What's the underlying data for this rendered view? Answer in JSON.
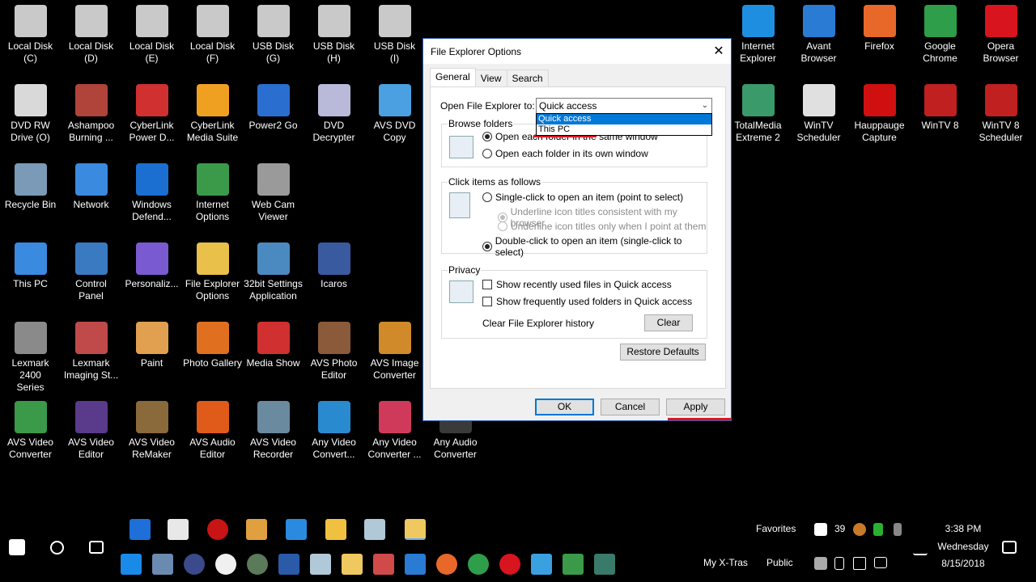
{
  "desktop": {
    "icons": [
      {
        "id": "local-disk-c",
        "label": "Local Disk\n(C)",
        "color": "#c9c9c9"
      },
      {
        "id": "local-disk-d",
        "label": "Local Disk\n(D)",
        "color": "#c9c9c9"
      },
      {
        "id": "local-disk-e",
        "label": "Local Disk\n(E)",
        "color": "#c9c9c9"
      },
      {
        "id": "local-disk-f",
        "label": "Local Disk\n(F)",
        "color": "#c9c9c9"
      },
      {
        "id": "usb-disk-g",
        "label": "USB Disk\n(G)",
        "color": "#c9c9c9"
      },
      {
        "id": "usb-disk-h",
        "label": "USB Disk\n(H)",
        "color": "#c9c9c9"
      },
      {
        "id": "usb-disk-i",
        "label": "USB Disk\n(I)",
        "color": "#c9c9c9"
      },
      {
        "id": "internet-explorer",
        "label": "Internet\nExplorer",
        "color": "#1e8fe0"
      },
      {
        "id": "avant-browser",
        "label": "Avant\nBrowser",
        "color": "#2a7bd4"
      },
      {
        "id": "firefox",
        "label": "Firefox",
        "color": "#e8682a"
      },
      {
        "id": "google-chrome",
        "label": "Google\nChrome",
        "color": "#2e9e4a"
      },
      {
        "id": "opera-browser",
        "label": "Opera\nBrowser",
        "color": "#d8141e"
      },
      {
        "id": "dvd-rw-drive",
        "label": "DVD RW\nDrive (O)",
        "color": "#d9d9d9"
      },
      {
        "id": "ashampoo",
        "label": "Ashampoo\nBurning ...",
        "color": "#b0443a"
      },
      {
        "id": "cyberlink-powerd",
        "label": "CyberLink\nPower D...",
        "color": "#d03030"
      },
      {
        "id": "cyberlink-media",
        "label": "CyberLink\nMedia Suite",
        "color": "#f0a020"
      },
      {
        "id": "power2go",
        "label": "Power2 Go",
        "color": "#2a6fd0"
      },
      {
        "id": "dvd-decrypter",
        "label": "DVD\nDecrypter",
        "color": "#b9b9d9"
      },
      {
        "id": "avs-dvd-copy",
        "label": "AVS DVD\nCopy",
        "color": "#4aa0e0"
      },
      {
        "id": "totalmedia",
        "label": "TotalMedia\nExtreme 2",
        "color": "#3a9a6a"
      },
      {
        "id": "wintv-scheduler",
        "label": "WinTV\nScheduler",
        "color": "#e0e0e0"
      },
      {
        "id": "hauppauge",
        "label": "Hauppauge\nCapture",
        "color": "#d01010"
      },
      {
        "id": "wintv-8",
        "label": "WinTV 8",
        "color": "#c02020"
      },
      {
        "id": "wintv-8-scheduler",
        "label": "WinTV 8\nScheduler",
        "color": "#c02020"
      },
      {
        "id": "recycle-bin",
        "label": "Recycle Bin",
        "color": "#7a9ab8"
      },
      {
        "id": "network",
        "label": "Network",
        "color": "#3a8ae0"
      },
      {
        "id": "windows-defender",
        "label": "Windows\nDefend...",
        "color": "#1a6fd0"
      },
      {
        "id": "internet-options",
        "label": "Internet\nOptions",
        "color": "#3a9a4a"
      },
      {
        "id": "web-cam-viewer",
        "label": "Web Cam\nViewer",
        "color": "#9a9a9a"
      },
      {
        "id": "this-pc",
        "label": "This PC",
        "color": "#3a8ae0"
      },
      {
        "id": "control-panel",
        "label": "Control\nPanel",
        "color": "#3a7ac0"
      },
      {
        "id": "personalize",
        "label": "Personaliz...",
        "color": "#7a5ad0"
      },
      {
        "id": "file-explorer-options",
        "label": "File Explorer\nOptions",
        "color": "#e8c04a"
      },
      {
        "id": "32bit-settings",
        "label": "32bit Settings\nApplication",
        "color": "#4a8ac0"
      },
      {
        "id": "icaros",
        "label": "Icaros",
        "color": "#3a5aa0"
      },
      {
        "id": "lexmark-2400",
        "label": "Lexmark 2400\nSeries",
        "color": "#8a8a8a"
      },
      {
        "id": "lexmark-imaging",
        "label": "Lexmark\nImaging St...",
        "color": "#c04a4a"
      },
      {
        "id": "paint",
        "label": "Paint",
        "color": "#e0a050"
      },
      {
        "id": "photo-gallery",
        "label": "Photo Gallery",
        "color": "#e07020"
      },
      {
        "id": "media-show",
        "label": "Media Show",
        "color": "#d03030"
      },
      {
        "id": "avs-photo-editor",
        "label": "AVS Photo\nEditor",
        "color": "#8a5a3a"
      },
      {
        "id": "avs-image-converter",
        "label": "AVS Image\nConverter",
        "color": "#d08a2a"
      },
      {
        "id": "avs-video-converter",
        "label": "AVS Video\nConverter",
        "color": "#3a9a4a"
      },
      {
        "id": "avs-video-editor",
        "label": "AVS Video\nEditor",
        "color": "#5a3a8a"
      },
      {
        "id": "avs-video-remaker",
        "label": "AVS Video\nReMaker",
        "color": "#8a6a3a"
      },
      {
        "id": "avs-audio-editor",
        "label": "AVS Audio\nEditor",
        "color": "#e05a1a"
      },
      {
        "id": "avs-video-recorder",
        "label": "AVS Video\nRecorder",
        "color": "#6a8aa0"
      },
      {
        "id": "any-video-convert",
        "label": "Any Video\nConvert...",
        "color": "#2a8ad0"
      },
      {
        "id": "any-video-converter",
        "label": "Any Video\nConverter ...",
        "color": "#d03a5a"
      },
      {
        "id": "any-audio-converter",
        "label": "Any Audio\nConverter",
        "color": "#3a3a3a"
      }
    ]
  },
  "dialog": {
    "title": "File Explorer Options",
    "close": "✕",
    "tabs": [
      "General",
      "View",
      "Search"
    ],
    "open_to_label": "Open File Explorer to:",
    "open_to_value": "Quick access",
    "open_to_options": [
      "Quick access",
      "This PC"
    ],
    "browse_folders": {
      "legend": "Browse folders",
      "opt1": "Open each folder in the same window",
      "opt2": "Open each folder in its own window"
    },
    "click_items": {
      "legend": "Click items as follows",
      "single": "Single-click to open an item (point to select)",
      "underline_browser": "Underline icon titles consistent with my browser",
      "underline_point": "Underline icon titles only when I point at them",
      "double": "Double-click to open an item (single-click to select)"
    },
    "privacy": {
      "legend": "Privacy",
      "recent_files": "Show recently used files in Quick access",
      "frequent_folders": "Show frequently used folders in Quick access",
      "clear_label": "Clear File Explorer history",
      "clear_button": "Clear"
    },
    "restore_defaults": "Restore Defaults",
    "ok": "OK",
    "cancel": "Cancel",
    "apply": "Apply"
  },
  "taskbar": {
    "favorites": "Favorites",
    "my_xtras": "My X-Tras",
    "public": "Public",
    "tray_number": "39",
    "time": "3:38 PM",
    "day": "Wednesday",
    "date": "8/15/2018"
  },
  "colors": {
    "accent": "#0078d7",
    "annotation_red": "#e0141e"
  }
}
